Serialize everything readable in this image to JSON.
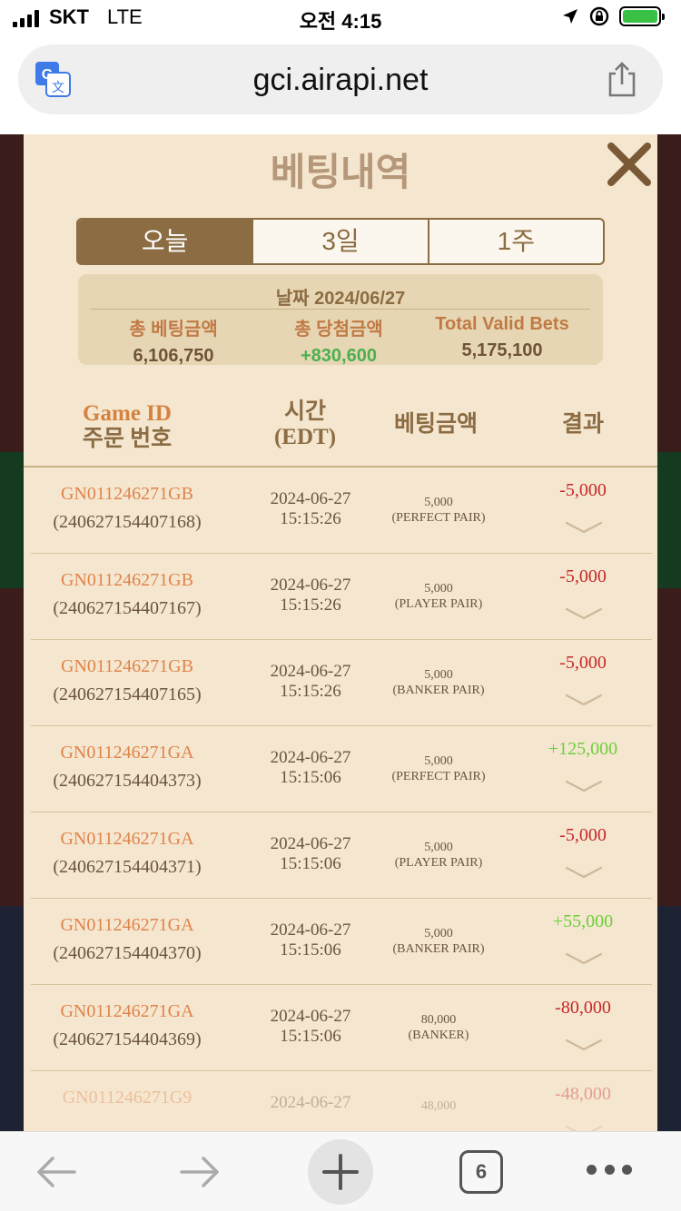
{
  "status_bar": {
    "carrier": "SKT",
    "network": "LTE",
    "time": "오전 4:15"
  },
  "browser": {
    "url": "gci.airapi.net",
    "tab_count": "6"
  },
  "modal": {
    "title": "베팅내역",
    "tabs": [
      {
        "label": "오늘",
        "active": true
      },
      {
        "label": "3일",
        "active": false
      },
      {
        "label": "1주",
        "active": false
      }
    ],
    "summary": {
      "date_label": "날짜",
      "date": "2024/06/27",
      "total_bet_label": "총 베팅금액",
      "total_bet": "6,106,750",
      "total_win_label": "총 당첨금액",
      "total_win": "+830,600",
      "valid_bets_label": "Total Valid Bets",
      "valid_bets": "5,175,100"
    },
    "columns": {
      "game_id": "Game ID",
      "order_no": "주문 번호",
      "time": "시간",
      "timezone": "(EDT)",
      "bet_amount": "베팅금액",
      "result": "결과"
    },
    "rows": [
      {
        "game_id": "GN011246271GB",
        "order_no": "(240627154407168)",
        "date": "2024-06-27",
        "time": "15:15:26",
        "amount": "5,000",
        "bet_type": "(PERFECT PAIR)",
        "result": "-5,000",
        "status": "neg"
      },
      {
        "game_id": "GN011246271GB",
        "order_no": "(240627154407167)",
        "date": "2024-06-27",
        "time": "15:15:26",
        "amount": "5,000",
        "bet_type": "(PLAYER PAIR)",
        "result": "-5,000",
        "status": "neg"
      },
      {
        "game_id": "GN011246271GB",
        "order_no": "(240627154407165)",
        "date": "2024-06-27",
        "time": "15:15:26",
        "amount": "5,000",
        "bet_type": "(BANKER PAIR)",
        "result": "-5,000",
        "status": "neg"
      },
      {
        "game_id": "GN011246271GA",
        "order_no": "(240627154404373)",
        "date": "2024-06-27",
        "time": "15:15:06",
        "amount": "5,000",
        "bet_type": "(PERFECT PAIR)",
        "result": "+125,000",
        "status": "pos"
      },
      {
        "game_id": "GN011246271GA",
        "order_no": "(240627154404371)",
        "date": "2024-06-27",
        "time": "15:15:06",
        "amount": "5,000",
        "bet_type": "(PLAYER PAIR)",
        "result": "-5,000",
        "status": "neg"
      },
      {
        "game_id": "GN011246271GA",
        "order_no": "(240627154404370)",
        "date": "2024-06-27",
        "time": "15:15:06",
        "amount": "5,000",
        "bet_type": "(BANKER PAIR)",
        "result": "+55,000",
        "status": "pos"
      },
      {
        "game_id": "GN011246271GA",
        "order_no": "(240627154404369)",
        "date": "2024-06-27",
        "time": "15:15:06",
        "amount": "80,000",
        "bet_type": "(BANKER)",
        "result": "-80,000",
        "status": "neg"
      },
      {
        "game_id": "GN011246271G9",
        "order_no": "",
        "date": "2024-06-27",
        "time": "",
        "amount": "48,000",
        "bet_type": "",
        "result": "-48,000",
        "status": "neg",
        "faded": true
      }
    ]
  },
  "colors": {
    "modal_bg": "#f5e6cf",
    "accent_brown": "#8b6c43",
    "negative": "#c62828",
    "positive": "#6ccf3c",
    "game_id": "#e0844a"
  }
}
